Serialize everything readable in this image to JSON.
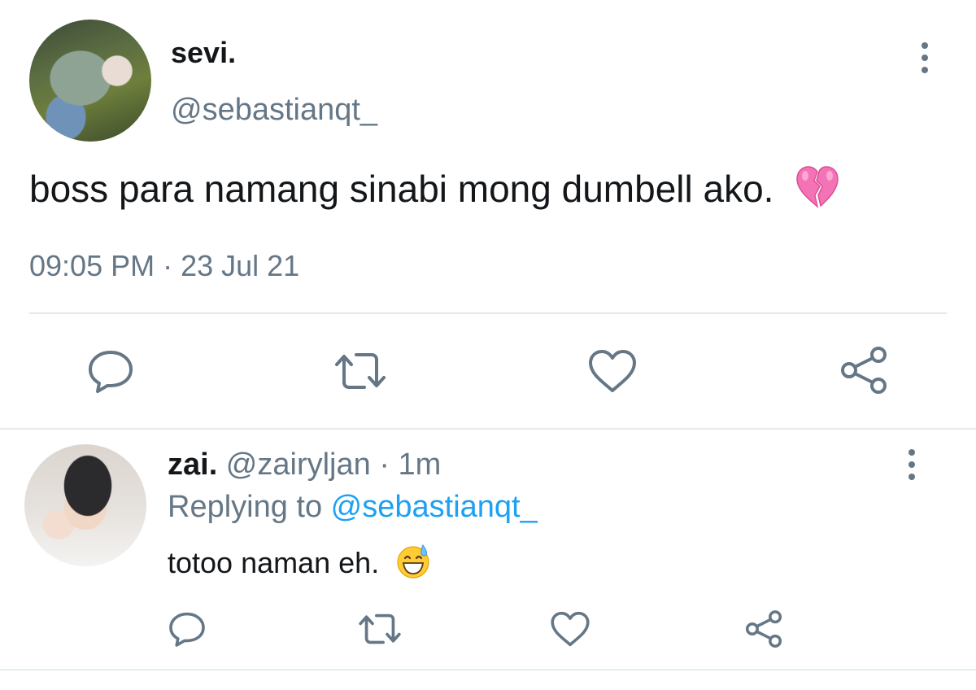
{
  "main_tweet": {
    "display_name": "sevi.",
    "handle": "@sebastianqt_",
    "text": "boss para namang sinabi mong dumbell ako.",
    "emoji": "broken-heart-icon",
    "timestamp": "09:05 PM · 23 Jul 21"
  },
  "reply_tweet": {
    "display_name": "zai.",
    "meta": " @zairyljan · 1m",
    "replying_prefix": "Replying to ",
    "replying_handle": "@sebastianqt_",
    "text": "totoo naman eh.",
    "emoji": "grinning-sweat-icon"
  },
  "actions": [
    "reply",
    "retweet",
    "like",
    "share"
  ],
  "colors": {
    "text": "#14171a",
    "secondary": "#657786",
    "link": "#1da1f2",
    "divider": "#e1e8ed",
    "heart": "#f472b6"
  }
}
